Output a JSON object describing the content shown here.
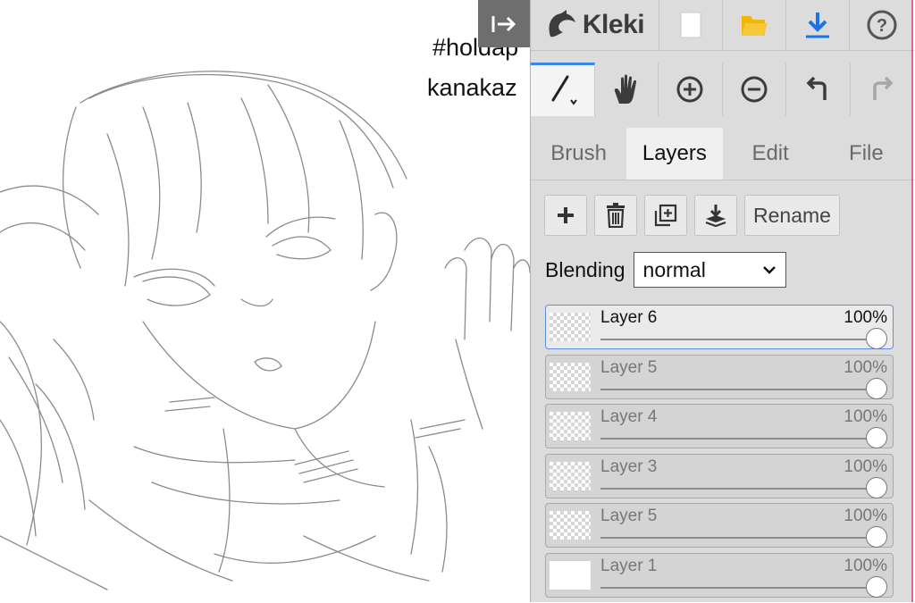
{
  "app": {
    "name": "Kleki"
  },
  "canvas": {
    "overlay_lines": [
      "#holdap",
      "kanakaz"
    ]
  },
  "toolbar_top": {
    "items": [
      {
        "name": "new-image",
        "icon": "new-document-icon"
      },
      {
        "name": "open-image",
        "icon": "folder-icon"
      },
      {
        "name": "save-image",
        "icon": "download-icon"
      },
      {
        "name": "help",
        "icon": "help-icon"
      }
    ]
  },
  "toolbar_tools": {
    "items": [
      {
        "name": "brush",
        "icon": "brush-icon",
        "active": true
      },
      {
        "name": "hand",
        "icon": "hand-icon"
      },
      {
        "name": "zoom-in",
        "icon": "zoom-in-icon"
      },
      {
        "name": "zoom-out",
        "icon": "zoom-out-icon"
      },
      {
        "name": "undo",
        "icon": "undo-icon"
      },
      {
        "name": "redo",
        "icon": "redo-icon",
        "disabled": true
      }
    ]
  },
  "tabs": [
    {
      "label": "Brush"
    },
    {
      "label": "Layers",
      "active": true
    },
    {
      "label": "Edit"
    },
    {
      "label": "File"
    }
  ],
  "layer_tools": {
    "rename_label": "Rename",
    "icons": [
      "add-layer-icon",
      "delete-layer-icon",
      "duplicate-layer-icon",
      "merge-down-icon"
    ]
  },
  "blending": {
    "label": "Blending",
    "value": "normal"
  },
  "layers": [
    {
      "name": "Layer 6",
      "opacity_label": "100%",
      "opacity": 1.0,
      "selected": true,
      "thumb": "transparent"
    },
    {
      "name": "Layer 5",
      "opacity_label": "100%",
      "opacity": 1.0,
      "thumb": "transparent"
    },
    {
      "name": "Layer 4",
      "opacity_label": "100%",
      "opacity": 1.0,
      "thumb": "transparent"
    },
    {
      "name": "Layer 3",
      "opacity_label": "100%",
      "opacity": 1.0,
      "thumb": "transparent"
    },
    {
      "name": "Layer 5",
      "opacity_label": "100%",
      "opacity": 1.0,
      "thumb": "transparent"
    },
    {
      "name": "Layer 1",
      "opacity_label": "100%",
      "opacity": 1.0,
      "thumb": "white"
    }
  ],
  "colors": {
    "accent": "#3a86e8",
    "panel_bg": "#dcdcdc",
    "folder": "#f2b705",
    "download": "#1a73e8",
    "edge": "#e8609a"
  }
}
